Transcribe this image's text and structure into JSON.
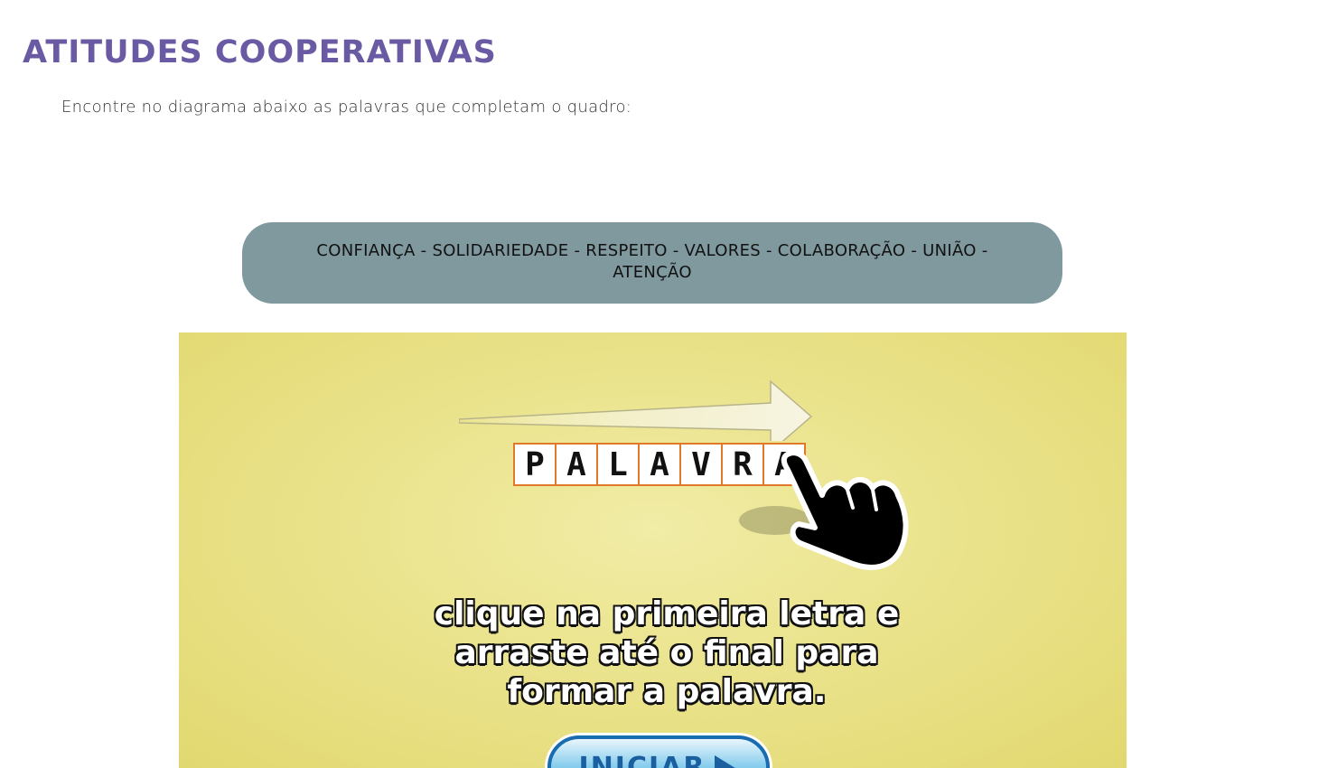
{
  "page": {
    "title": "ATITUDES COOPERATIVAS",
    "instructions": "Encontre no diagrama abaixo as palavras que completam o quadro:"
  },
  "word_list": {
    "text": "CONFIANÇA - SOLIDARIEDADE - RESPEITO - VALORES - COLABORAÇÃO - UNIÃO - ATENÇÃO"
  },
  "game": {
    "example_letters": [
      "P",
      "A",
      "L",
      "A",
      "V",
      "R",
      "A"
    ],
    "instruction_line1": "clique na primeira letra e",
    "instruction_line2": "arraste até o final para",
    "instruction_line3": "formar a palavra.",
    "start_button_label": "INICIAR",
    "colors": {
      "background": "#ebe48f",
      "tile_border": "#e07a2a",
      "button_border": "#1a6cb0"
    },
    "icons": [
      "arrow-right-icon",
      "pointing-hand-icon",
      "play-icon"
    ]
  },
  "colors": {
    "title": "#6a5aa4",
    "word_box_bg": "#7f999f"
  }
}
